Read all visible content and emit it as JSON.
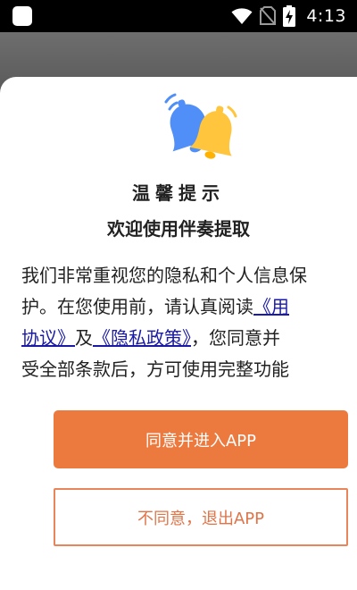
{
  "status_bar": {
    "time": "4:13",
    "icons": [
      "app-notification-icon",
      "wifi-icon",
      "no-sim-icon",
      "battery-charging-icon"
    ]
  },
  "dialog": {
    "title": "温馨提示",
    "subtitle": "欢迎使用伴奏提取",
    "body": {
      "line1": "我们非常重视您的隐私和个人信息保",
      "line2_text": "护。在您使用前，请认真阅读",
      "user_agreement_link": "《用户协议》",
      "user_agreement_part1": "《用",
      "user_agreement_part2": "协议》",
      "connector": "及",
      "privacy_policy_link": "《隐私政策》",
      "line3_text": "，您同意并",
      "line4": "受全部条款后，方可使用完整功能"
    },
    "agree_label": "同意并进入APP",
    "disagree_label": "不同意，退出APP"
  },
  "colors": {
    "accent": "#ec7a3f",
    "link": "#1a1aa6",
    "bell_blue": "#4f8ff7",
    "bell_yellow": "#ffc53d"
  }
}
